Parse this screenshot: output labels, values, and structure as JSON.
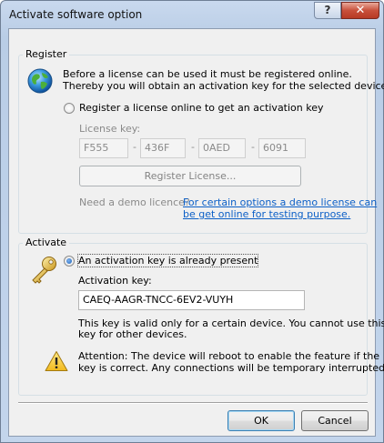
{
  "window": {
    "title": "Activate software option",
    "help_glyph": "?",
    "close_glyph": "✕"
  },
  "register": {
    "group_title": "Register",
    "intro_line1": "Before a license can be used it must be registered online.",
    "intro_line2": "Thereby you will obtain an activation key for the selected device.",
    "icon": "globe-icon",
    "radio_label": "Register a license online to get an activation key",
    "radio_selected": false,
    "license_key_label": "License key:",
    "license_key_parts": [
      "F555",
      "436F",
      "0AED",
      "6091"
    ],
    "register_button": "Register License...",
    "demo_label": "Need a demo licence?",
    "demo_link_line1": "For certain options a demo license can",
    "demo_link_line2": "be get online for testing purpose."
  },
  "activate": {
    "group_title": "Activate",
    "icon": "key-icon",
    "radio_label": "An activation key is already present",
    "radio_selected": true,
    "activation_key_label": "Activation key:",
    "activation_key_value": "CAEQ-AAGR-TNCC-6EV2-VUYH",
    "note_line1": "This key is valid only for a certain device. You cannot use this",
    "note_line2": "key for other devices.",
    "warning_icon": "warning-icon",
    "warning_line1": "Attention: The device will reboot to enable the feature if the",
    "warning_line2": "key is correct. Any connections will be temporary interrupted!"
  },
  "buttons": {
    "ok": "OK",
    "cancel": "Cancel"
  }
}
